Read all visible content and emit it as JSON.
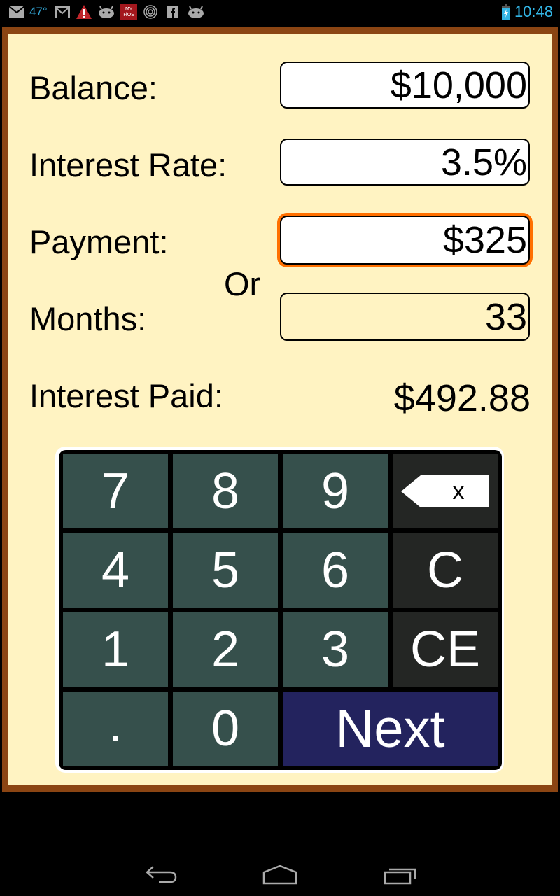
{
  "status_bar": {
    "left_icons": [
      "gmail-envelope-icon",
      "weather-icon",
      "gmail-icon",
      "warning-icon",
      "android-icon",
      "myfios-icon",
      "radio-icon",
      "facebook-icon",
      "android-icon"
    ],
    "temperature": "47°",
    "myfios_label": "MY FiOS",
    "time": "10:48",
    "battery": "charging"
  },
  "form": {
    "balance": {
      "label": "Balance:",
      "value": "$10,000"
    },
    "interest_rate": {
      "label": "Interest Rate:",
      "value": "3.5%"
    },
    "payment": {
      "label": "Payment:",
      "value": "$325",
      "focused": true
    },
    "or_label": "Or",
    "months": {
      "label": "Months:",
      "value": "33"
    },
    "interest_paid": {
      "label": "Interest Paid:",
      "value": "$492.88"
    }
  },
  "keypad": {
    "keys": [
      "7",
      "8",
      "9",
      "⌫",
      "4",
      "5",
      "6",
      "C",
      "1",
      "2",
      "3",
      "CE",
      ".",
      "0",
      "Next"
    ],
    "backspace_label": "x"
  },
  "colors": {
    "frame": "#8b4513",
    "panel": "#fff3c2",
    "focus": "#ff6f00",
    "num_key": "#36504c",
    "fn_key": "#242624",
    "next_key": "#23235e"
  }
}
